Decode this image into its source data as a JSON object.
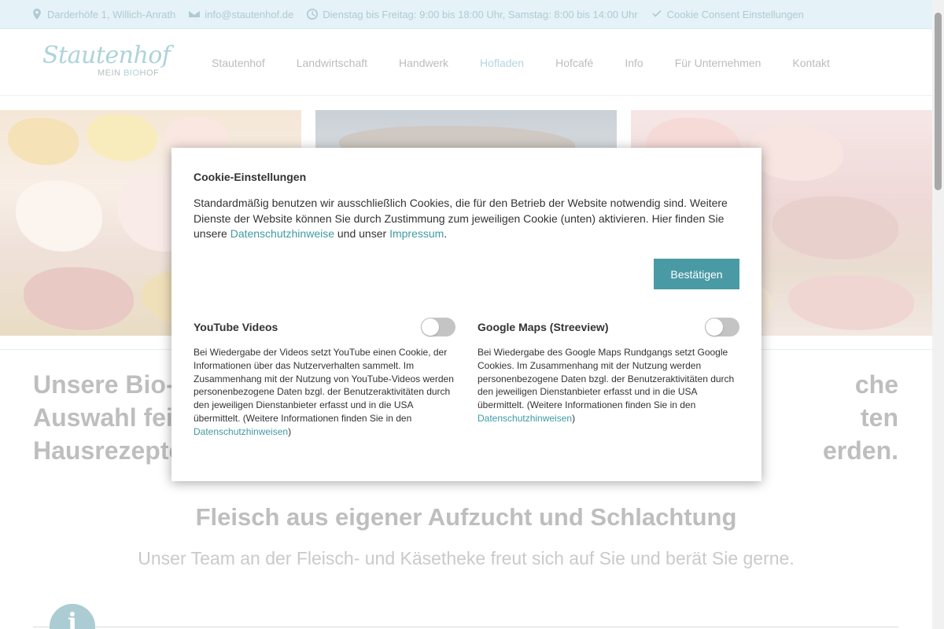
{
  "topbar": {
    "address": "Darderhöfe 1, Willich-Anrath",
    "email": "info@stautenhof.de",
    "hours": "Dienstag bis Freitag: 9:00 bis 18:00 Uhr, Samstag: 8:00 bis 14:00 Uhr",
    "cookie_link": "Cookie Consent Einstellungen"
  },
  "logo": {
    "script": "Stautenhof",
    "sub_prefix": "MEIN ",
    "sub_bio": "BIO",
    "sub_suffix": "HOF"
  },
  "nav": {
    "items": [
      "Stautenhof",
      "Landwirtschaft",
      "Handwerk",
      "Hofladen",
      "Hofcafé",
      "Info",
      "Für Unternehmen",
      "Kontakt"
    ],
    "active": "Hofladen"
  },
  "main": {
    "headline_row1_left": "Unsere Bio-",
    "headline_row1_right": "che",
    "headline_row2_left": "Auswahl fei",
    "headline_row2_right": "ten",
    "headline_row3_left": "Hausrezepte",
    "headline_row3_right": "erden.",
    "section_title": "Fleisch aus eigener Aufzucht und Schlachtung",
    "section_subtitle": "Unser Team an der Fleisch- und Käsetheke freut sich auf Sie und berät Sie gerne.",
    "info_glyph": "i"
  },
  "modal": {
    "title": "Cookie-Einstellungen",
    "text_before": "Standardmäßig benutzen wir ausschließlich Cookies, die für den Betrieb der Website notwendig sind. Weitere Dienste der Website können Sie durch Zustimmung zum jeweiligen Cookie (unten) aktivieren. Hier finden Sie unsere ",
    "privacy_link": "Datenschutzhinweise",
    "text_middle": " und unser ",
    "imprint_link": "Impressum",
    "text_after": ".",
    "confirm_label": "Bestätigen",
    "youtube": {
      "title": "YouTube Videos",
      "enabled": false,
      "text": "Bei Wiedergabe der Videos setzt YouTube einen Cookie, der Informationen über das Nutzerverhalten sammelt. Im Zusammenhang mit der Nutzung von YouTube-Videos werden personenbezogene Daten bzgl. der Benutzeraktivitäten durch den jeweiligen Dienstanbieter erfasst und in die USA übermittelt. (Weitere Informationen finden Sie in den ",
      "link": "Datenschutzhinweisen",
      "close": ")"
    },
    "maps": {
      "title": "Google Maps (Streeview)",
      "enabled": false,
      "text": "Bei Wiedergabe des Google Maps Rundgangs setzt Google Cookies. Im Zusammenhang mit der Nutzung werden personenbezogene Daten bzgl. der Benutzeraktivitäten durch den jeweiligen Dienstanbieter erfasst und in die USA übermittelt. (Weitere Informationen finden Sie in den ",
      "link": "Datenschutzhinweisen",
      "close": ")"
    }
  },
  "colors": {
    "accent": "#4a9aa5",
    "topbar_bg": "#dbeef4",
    "link": "#3f9aa5"
  }
}
